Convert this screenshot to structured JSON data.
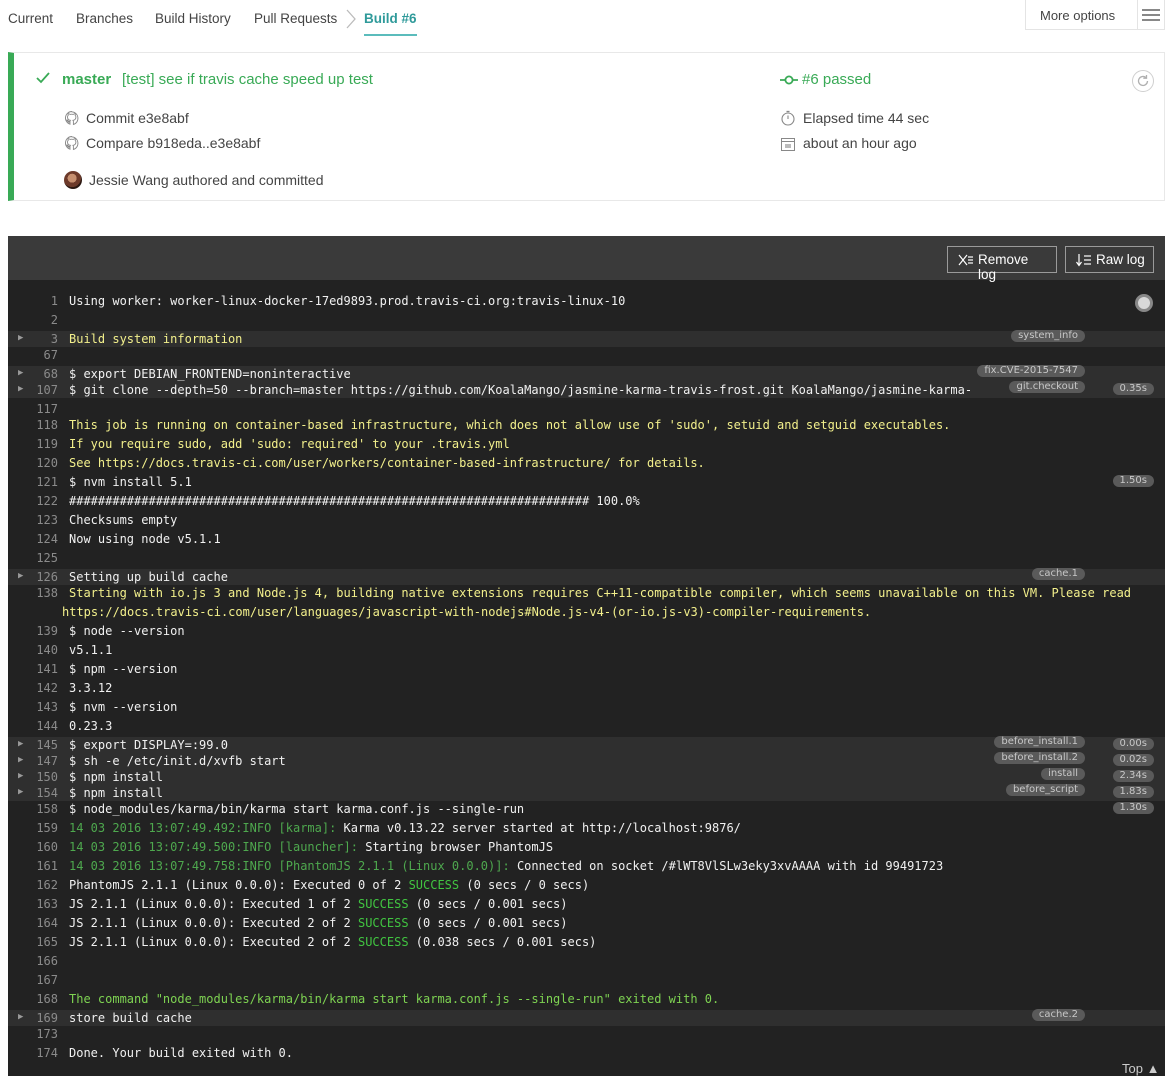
{
  "nav": {
    "tabs": [
      "Current",
      "Branches",
      "Build History",
      "Pull Requests"
    ],
    "active": "Build #6",
    "more": "More options"
  },
  "summary": {
    "branch": "master",
    "message": "[test] see if travis cache speed up test",
    "commit": "Commit e3e8abf",
    "compare": "Compare b918eda..e3e8abf",
    "author": "Jessie Wang authored and committed",
    "status": "#6 passed",
    "elapsed": "Elapsed time 44 sec",
    "when": "about an hour ago",
    "colors": {
      "passed": "#39aa56",
      "accent": "#2f9a9a"
    }
  },
  "log": {
    "remove": "Remove log",
    "raw": "Raw log",
    "top": "Top",
    "lines": [
      {
        "n": "1",
        "t": "Using worker: worker-linux-docker-17ed9893.prod.travis-ci.org:travis-linux-10"
      },
      {
        "n": "2",
        "t": ""
      },
      {
        "n": "3",
        "t": "Build system information",
        "tag": "system_info",
        "fold": true,
        "c": "y"
      },
      {
        "n": "67",
        "t": ""
      },
      {
        "n": "68",
        "t": "$ export DEBIAN_FRONTEND=noninteractive",
        "tag": "fix.CVE-2015-7547",
        "fold": true
      },
      {
        "n": "107",
        "t": "$ git clone --depth=50 --branch=master https://github.com/KoalaMango/jasmine-karma-travis-frost.git KoalaMango/jasmine-karma-",
        "tag": "git.checkout",
        "time": "0.35s",
        "fold": true
      },
      {
        "n": "117",
        "t": ""
      },
      {
        "n": "118",
        "t": "This job is running on container-based infrastructure, which does not allow use of 'sudo', setuid and setguid executables.",
        "c": "y"
      },
      {
        "n": "119",
        "t": "If you require sudo, add 'sudo: required' to your .travis.yml",
        "c": "y"
      },
      {
        "n": "120",
        "t": "See https://docs.travis-ci.com/user/workers/container-based-infrastructure/ for details.",
        "c": "y"
      },
      {
        "n": "121",
        "t": "$ nvm install 5.1",
        "time": "1.50s"
      },
      {
        "n": "122",
        "t": "######################################################################## 100.0%"
      },
      {
        "n": "123",
        "t": "Checksums empty"
      },
      {
        "n": "124",
        "t": "Now using node v5.1.1"
      },
      {
        "n": "125",
        "t": ""
      },
      {
        "n": "126",
        "t": "Setting up build cache",
        "tag": "cache.1",
        "fold": true
      },
      {
        "n": "138",
        "t": "Starting with io.js 3 and Node.js 4, building native extensions requires C++11-compatible compiler, which seems unavailable on this VM. Please read",
        "c": "y"
      },
      {
        "n": "",
        "t": "https://docs.travis-ci.com/user/languages/javascript-with-nodejs#Node.js-v4-(or-io.js-v3)-compiler-requirements.",
        "c": "y",
        "wrap": true
      },
      {
        "n": "139",
        "t": "$ node --version"
      },
      {
        "n": "140",
        "t": "v5.1.1"
      },
      {
        "n": "141",
        "t": "$ npm --version"
      },
      {
        "n": "142",
        "t": "3.3.12"
      },
      {
        "n": "143",
        "t": "$ nvm --version"
      },
      {
        "n": "144",
        "t": "0.23.3"
      },
      {
        "n": "145",
        "t": "$ export DISPLAY=:99.0",
        "tag": "before_install.1",
        "time": "0.00s",
        "fold": true
      },
      {
        "n": "147",
        "t": "$ sh -e /etc/init.d/xvfb start",
        "tag": "before_install.2",
        "time": "0.02s",
        "fold": true
      },
      {
        "n": "150",
        "t": "$ npm install",
        "tag": "install",
        "time": "2.34s",
        "fold": true
      },
      {
        "n": "154",
        "t": "$ npm install",
        "tag": "before_script",
        "time": "1.83s",
        "fold": true
      },
      {
        "n": "158",
        "t": "$ node_modules/karma/bin/karma start karma.conf.js --single-run",
        "time": "1.30s"
      },
      {
        "n": "159",
        "pre": "14 03 2016 13:07:49.492:INFO [karma]: ",
        "t": "Karma v0.13.22 server started at http://localhost:9876/"
      },
      {
        "n": "160",
        "pre": "14 03 2016 13:07:49.500:INFO [launcher]: ",
        "t": "Starting browser PhantomJS"
      },
      {
        "n": "161",
        "pre": "14 03 2016 13:07:49.758:INFO [PhantomJS 2.1.1 (Linux 0.0.0)]: ",
        "t": "Connected on socket /#lWT8VlSLw3eky3xvAAAA with id 99491723"
      },
      {
        "n": "162",
        "t": "PhantomJS 2.1.1 (Linux 0.0.0): Executed 0 of 2 ",
        "ok": "SUCCESS",
        "post": " (0 secs / 0 secs)"
      },
      {
        "n": "163",
        "t": "JS 2.1.1 (Linux 0.0.0): Executed 1 of 2 ",
        "ok": "SUCCESS",
        "post": " (0 secs / 0.001 secs)"
      },
      {
        "n": "164",
        "t": "JS 2.1.1 (Linux 0.0.0): Executed 2 of 2 ",
        "ok": "SUCCESS",
        "post": " (0 secs / 0.001 secs)"
      },
      {
        "n": "165",
        "t": "JS 2.1.1 (Linux 0.0.0): Executed 2 of 2 ",
        "ok": "SUCCESS",
        "post": " (0.038 secs / 0.001 secs)"
      },
      {
        "n": "166",
        "t": ""
      },
      {
        "n": "167",
        "t": ""
      },
      {
        "n": "168",
        "t": "The command \"node_modules/karma/bin/karma start karma.conf.js --single-run\" exited with 0.",
        "c": "gr"
      },
      {
        "n": "169",
        "t": "store build cache",
        "tag": "cache.2",
        "fold": true
      },
      {
        "n": "173",
        "t": ""
      },
      {
        "n": "174",
        "t": "Done. Your build exited with 0."
      }
    ]
  }
}
